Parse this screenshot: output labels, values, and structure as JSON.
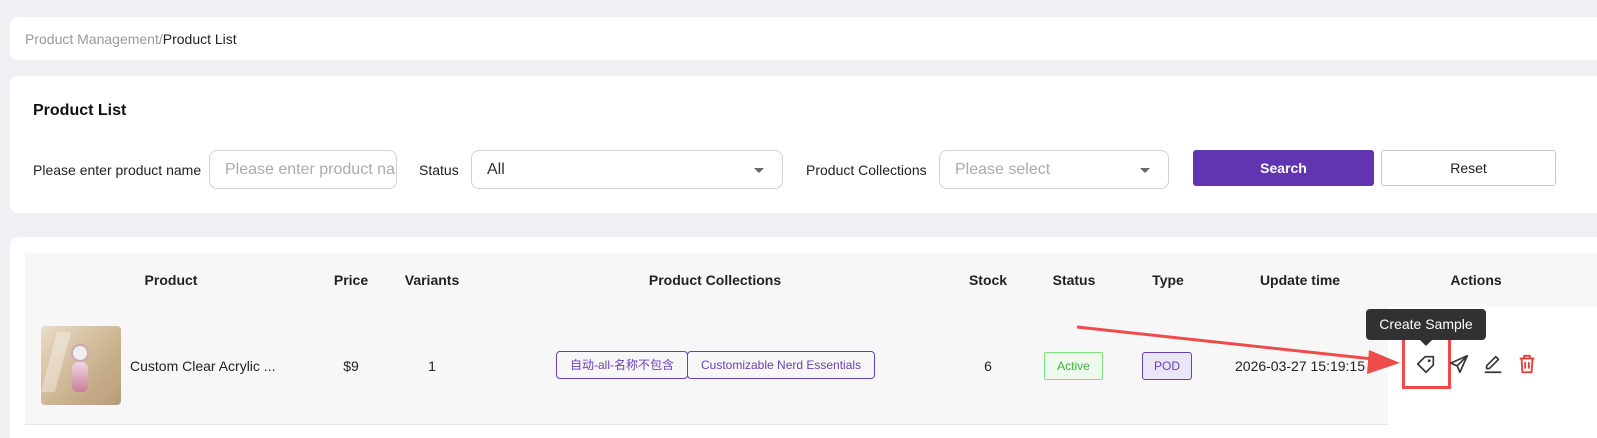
{
  "breadcrumb": {
    "parent": "Product Management",
    "separator": "/",
    "current": "Product List"
  },
  "filters": {
    "title": "Product List",
    "name_label": "Please enter product name",
    "name_placeholder": "Please enter product name",
    "status_label": "Status",
    "status_value": "All",
    "collections_label": "Product Collections",
    "collections_placeholder": "Please select",
    "search_label": "Search",
    "reset_label": "Reset"
  },
  "table": {
    "columns": [
      "Product",
      "Price",
      "Variants",
      "Product Collections",
      "Stock",
      "Status",
      "Type",
      "Update time",
      "Actions"
    ],
    "rows": [
      {
        "product_name": "Custom Clear Acrylic ...",
        "price": "$9",
        "variants": "1",
        "collections": [
          "自动-all-名称不包含",
          "Customizable Nerd Essentials"
        ],
        "stock": "6",
        "status": "Active",
        "type": "POD",
        "update_time": "2026-03-27 15:19:15",
        "actions": [
          "tag-icon",
          "send-icon",
          "edit-icon",
          "delete-icon"
        ]
      }
    ]
  },
  "tooltip": {
    "text": "Create Sample"
  },
  "colors": {
    "primary": "#6134b0",
    "active": "#3bb33a",
    "danger": "#e03b3b",
    "annotation": "#f04b4b"
  }
}
